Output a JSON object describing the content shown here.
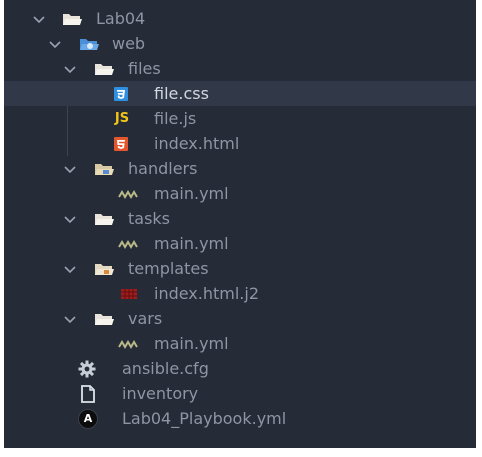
{
  "explorer": {
    "items": [
      {
        "label": "Lab04",
        "icon": "folder-open-icon",
        "expanded": true
      },
      {
        "label": "web",
        "icon": "folder-open-web-icon",
        "expanded": true
      },
      {
        "label": "files",
        "icon": "folder-open-icon",
        "expanded": true
      },
      {
        "label": "file.css",
        "icon": "css3-icon",
        "selected": true
      },
      {
        "label": "file.js",
        "icon": "js-icon"
      },
      {
        "label": "index.html",
        "icon": "html5-icon"
      },
      {
        "label": "handlers",
        "icon": "folder-open-handlers-icon",
        "expanded": true
      },
      {
        "label": "main.yml",
        "icon": "yaml-icon"
      },
      {
        "label": "tasks",
        "icon": "folder-open-icon",
        "expanded": true
      },
      {
        "label": "main.yml",
        "icon": "yaml-icon"
      },
      {
        "label": "templates",
        "icon": "folder-open-templates-icon",
        "expanded": true
      },
      {
        "label": "index.html.j2",
        "icon": "jinja-icon"
      },
      {
        "label": "vars",
        "icon": "folder-open-icon",
        "expanded": true
      },
      {
        "label": "main.yml",
        "icon": "yaml-icon"
      },
      {
        "label": "ansible.cfg",
        "icon": "gear-icon"
      },
      {
        "label": "inventory",
        "icon": "file-icon"
      },
      {
        "label": "Lab04_Playbook.yml",
        "icon": "ansible-icon"
      }
    ],
    "icon_text": {
      "js": "JS",
      "ansible": "A"
    },
    "colors": {
      "background": "#252b37",
      "selected_row": "#313847",
      "text": "#8e95a3",
      "active_text": "#d2d7e0",
      "folder": "#e8e4dc",
      "css": "#2f8fe0",
      "js": "#f0c419",
      "html": "#e4572e",
      "yaml": "#b9b98a",
      "jinja": "#b22222",
      "gear": "#c7ccd6"
    }
  }
}
